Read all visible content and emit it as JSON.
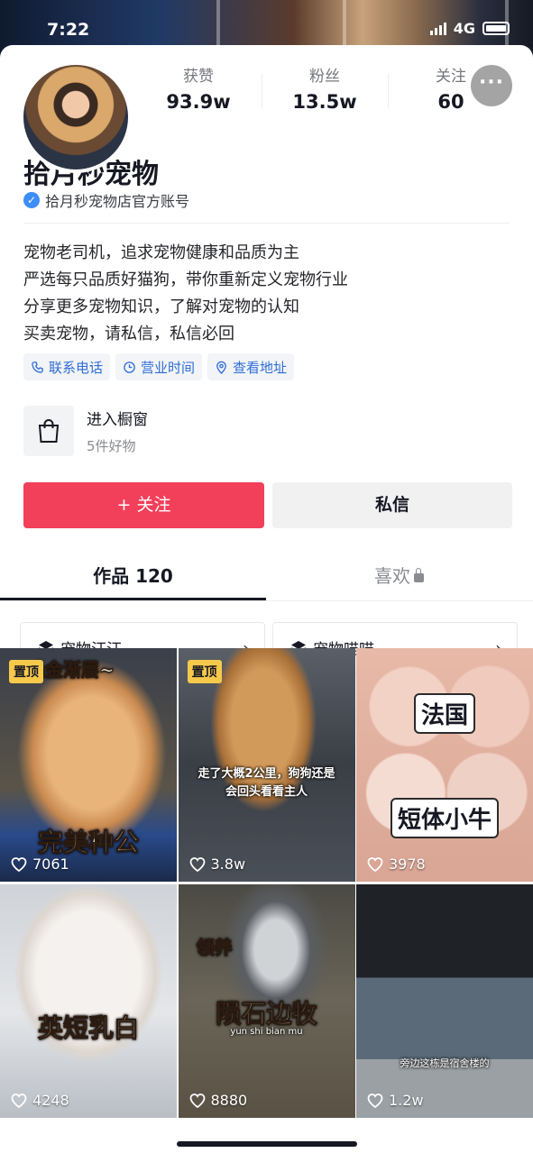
{
  "status_bar": {
    "time": "7:22",
    "network": "4G"
  },
  "profile": {
    "stats": [
      {
        "label": "获赞",
        "value": "93.9w"
      },
      {
        "label": "粉丝",
        "value": "13.5w"
      },
      {
        "label": "关注",
        "value": "60"
      }
    ],
    "name": "拾月秒宠物",
    "verified_text": "拾月秒宠物店官方账号",
    "bio": [
      "宠物老司机，追求宠物健康和品质为主",
      "严选每只品质好猫狗，带你重新定义宠物行业",
      "分享更多宠物知识，了解对宠物的认知",
      "买卖宠物，请私信，私信必回"
    ],
    "tags": [
      {
        "label": "联系电话",
        "icon": "phone-icon"
      },
      {
        "label": "营业时间",
        "icon": "clock-icon"
      },
      {
        "label": "查看地址",
        "icon": "location-icon"
      }
    ]
  },
  "shop": {
    "title": "进入橱窗",
    "subtitle": "5件好物"
  },
  "actions": {
    "follow": "+ 关注",
    "message": "私信"
  },
  "tabs": {
    "works": "作品 120",
    "likes": "喜欢"
  },
  "collections": [
    {
      "label": "宠物汪汪~"
    },
    {
      "label": "宠物喵喵~"
    }
  ],
  "videos": [
    {
      "pinned": "置顶",
      "likes": "7061",
      "caption_top": "毛金渐层~",
      "caption_bottom": "完美种公"
    },
    {
      "pinned": "置顶",
      "likes": "3.8w",
      "caption_mid": "走了大概2公里，狗狗还是会回头看看主人"
    },
    {
      "likes": "3978",
      "caption_top": "法国",
      "caption_bottom": "短体小牛"
    },
    {
      "likes": "4248",
      "caption_bottom": "英短乳白"
    },
    {
      "likes": "8880",
      "caption_top": "领养",
      "caption_bottom": "陨石边牧",
      "caption_sub": "yun shi bian mu"
    },
    {
      "likes": "1.2w",
      "caption_sub": "旁边这栋是宿舍楼的"
    }
  ],
  "colors": {
    "accent": "#f23f5a",
    "link": "#2f6ed6",
    "pin": "#f7c94b"
  }
}
